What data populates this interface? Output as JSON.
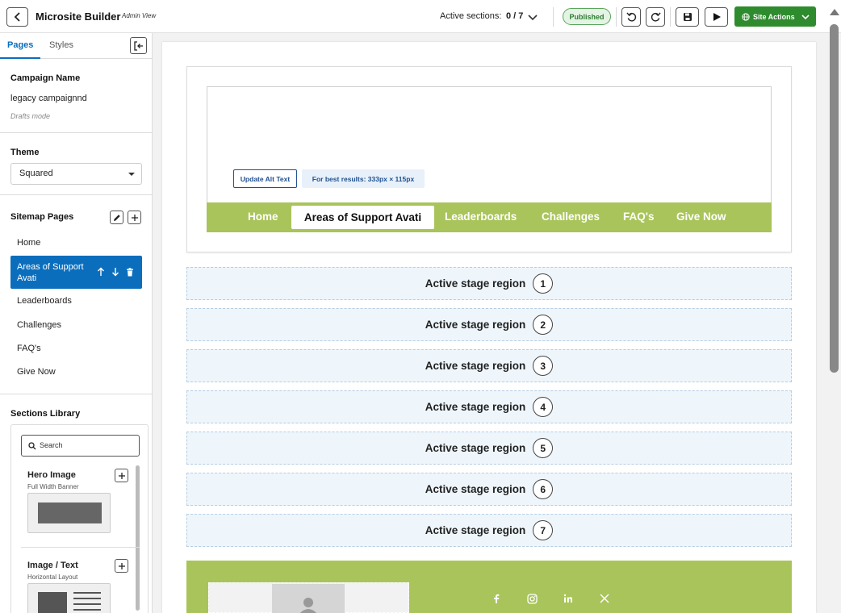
{
  "topbar": {
    "title": "Microsite Builder",
    "subtitle": "Admin View",
    "active_sections_label": "Active sections:",
    "active_sections_value": "0 / 7",
    "status_badge": "Published",
    "site_actions_label": "Site Actions"
  },
  "sidebar": {
    "tabs": [
      "Pages",
      "Styles"
    ],
    "campaign_name_label": "Campaign Name",
    "campaign_name_value": "legacy campaignnd",
    "mode_note": "Drafts mode",
    "theme_label": "Theme",
    "theme_value": "Squared",
    "sitemap_label": "Sitemap Pages",
    "pages": [
      "Home",
      "Areas of Support Avati",
      "Leaderboards",
      "Challenges",
      "FAQ's",
      "Give Now"
    ],
    "library_label": "Sections Library",
    "library_search_placeholder": "Search",
    "library_items": [
      {
        "title": "Hero Image",
        "subtitle": "Full Width Banner"
      },
      {
        "title": "Image / Text",
        "subtitle": "Horizontal Layout"
      }
    ]
  },
  "canvas": {
    "update_alt_text": "Update Alt Text",
    "best_results": "For best results: 333px × 115px",
    "nav": [
      "Home",
      "Areas of Support Avati",
      "Leaderboards",
      "Challenges",
      "FAQ's",
      "Give Now"
    ],
    "stage_label": "Active stage region",
    "stages": [
      "1",
      "2",
      "3",
      "4",
      "5",
      "6",
      "7"
    ]
  },
  "colors": {
    "accent_blue": "#0a6ebd",
    "nav_green": "#a9c45a",
    "action_green": "#2e8b2e",
    "stage_bg": "#eef6fc"
  }
}
